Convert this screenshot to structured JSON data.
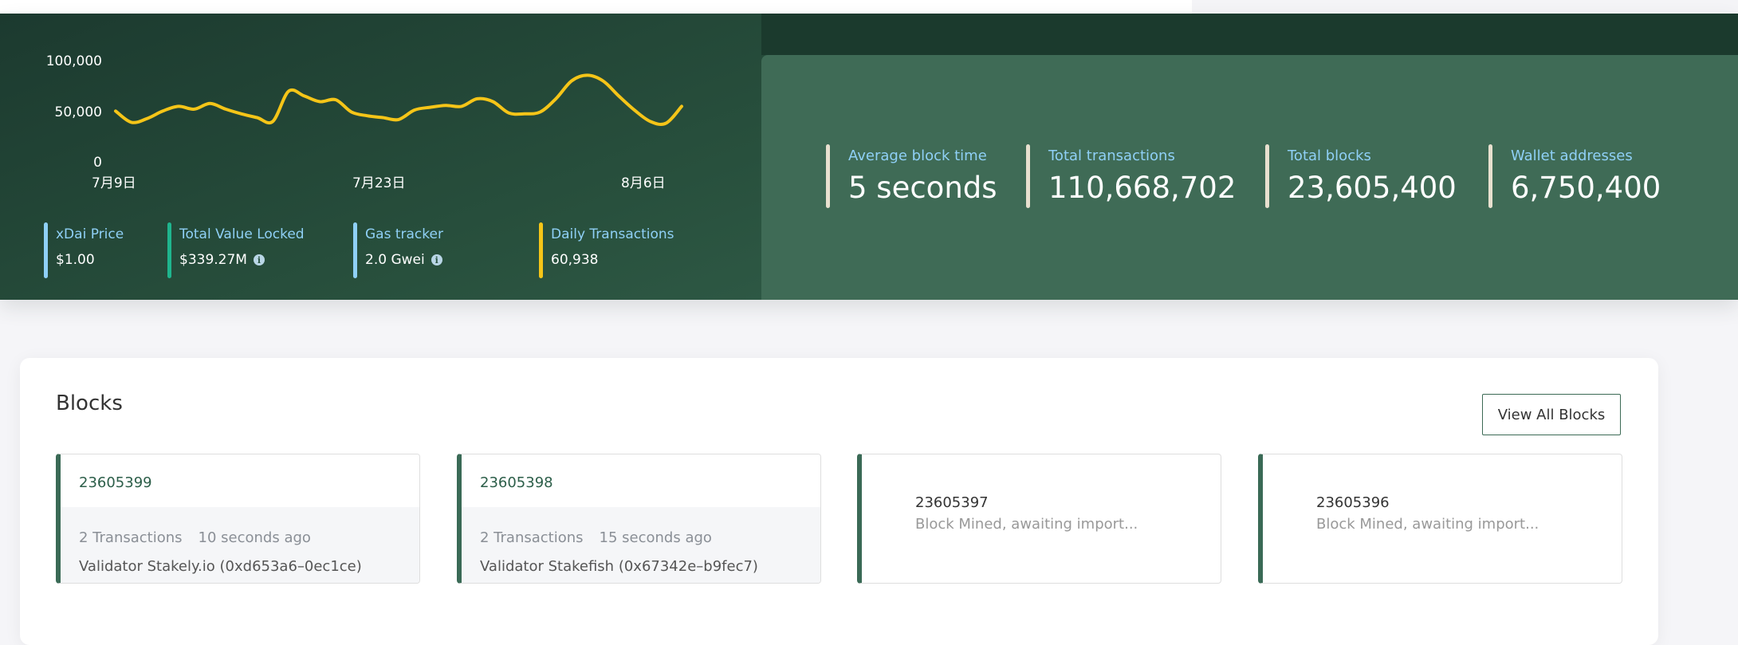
{
  "chart": {
    "y_ticks": [
      "100,000",
      "50,000",
      "0"
    ],
    "x_ticks": [
      "7月9日",
      "7月23日",
      "8月6日"
    ]
  },
  "chart_data": {
    "type": "line",
    "title": "",
    "xlabel": "",
    "ylabel": "",
    "x_tick_labels": [
      "7月9日",
      "7月23日",
      "8月6日"
    ],
    "ylim": [
      0,
      100000
    ],
    "grid": false,
    "series": [
      {
        "color": "#f5c518",
        "values": [
          54000,
          42000,
          46000,
          54000,
          59000,
          56000,
          62000,
          56000,
          51000,
          47000,
          43000,
          75000,
          70000,
          64000,
          66000,
          53000,
          49000,
          47000,
          45000,
          55000,
          58000,
          60000,
          59000,
          67000,
          64000,
          52000,
          51000,
          53000,
          67000,
          86000,
          92000,
          86000,
          70000,
          55000,
          43000,
          41000,
          59000
        ]
      }
    ]
  },
  "chart_stats": [
    {
      "label": "xDai Price",
      "value": "$1.00",
      "bar_color": "#8fd0f6",
      "info": false
    },
    {
      "label": "Total Value Locked",
      "value": "$339.27M",
      "bar_color": "#1fb58e",
      "info": true
    },
    {
      "label": "Gas tracker",
      "value": "2.0 Gwei",
      "bar_color": "#8fd0f6",
      "info": true
    },
    {
      "label": "Daily Transactions",
      "value": "60,938",
      "bar_color": "#f5c518",
      "info": false
    }
  ],
  "stats": [
    {
      "label": "Average block time",
      "value": "5 seconds"
    },
    {
      "label": "Total transactions",
      "value": "110,668,702"
    },
    {
      "label": "Total blocks",
      "value": "23,605,400"
    },
    {
      "label": "Wallet addresses",
      "value": "6,750,400"
    }
  ],
  "blocks": {
    "title": "Blocks",
    "view_all_label": "View All Blocks",
    "tiles": [
      {
        "number": "23605399",
        "transactions": "2 Transactions",
        "age": "10 seconds ago",
        "validator": "Validator Stakely.io (0xd653a6–0ec1ce)"
      },
      {
        "number": "23605398",
        "transactions": "2 Transactions",
        "age": "15 seconds ago",
        "validator": "Validator Stakefish (0x67342e–b9fec7)"
      },
      {
        "number": "23605397",
        "status": "Block Mined, awaiting import..."
      },
      {
        "number": "23605396",
        "status": "Block Mined, awaiting import..."
      }
    ]
  }
}
